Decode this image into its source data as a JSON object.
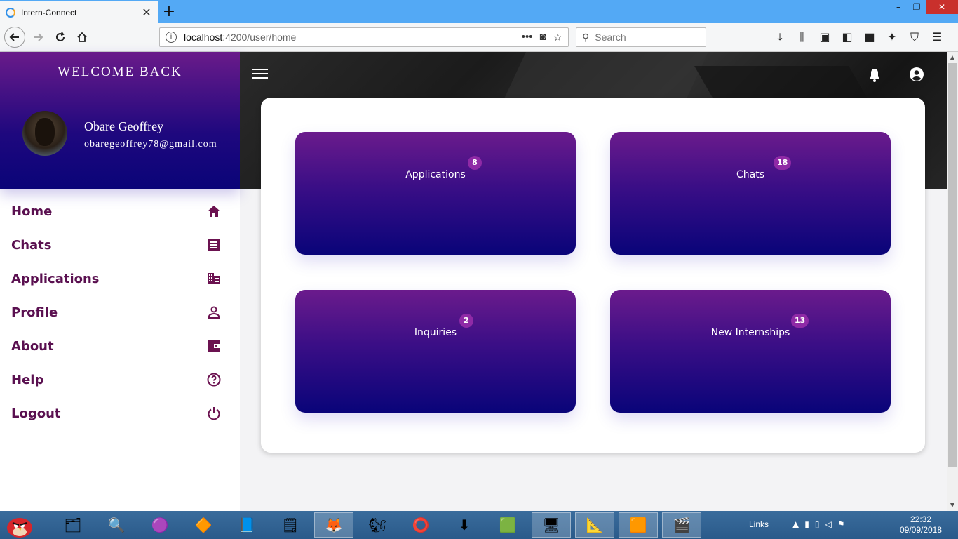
{
  "browser": {
    "tab_title": "Intern-Connect",
    "tab_close": "✕",
    "new_tab": "+",
    "url_host": "localhost",
    "url_path": ":4200/user/home",
    "search_placeholder": "Search",
    "window_controls": [
      "–",
      "❐",
      "✕"
    ]
  },
  "sidebar": {
    "welcome": "WELCOME BACK",
    "user_name": "Obare Geoffrey",
    "user_email": "obaregeoffrey78@gmail.com",
    "menu": [
      {
        "label": "Home",
        "icon": "home-icon"
      },
      {
        "label": "Chats",
        "icon": "chat-list-icon"
      },
      {
        "label": "Applications",
        "icon": "building-icon"
      },
      {
        "label": "Profile",
        "icon": "person-icon"
      },
      {
        "label": "About",
        "icon": "wallet-icon"
      },
      {
        "label": "Help",
        "icon": "help-circle-icon"
      },
      {
        "label": "Logout",
        "icon": "power-icon"
      }
    ]
  },
  "dashboard": {
    "tiles": [
      {
        "label": "Applications",
        "count": "8"
      },
      {
        "label": "Chats",
        "count": "18"
      },
      {
        "label": "Inquiries",
        "count": "2"
      },
      {
        "label": "New Internships",
        "count": "13"
      }
    ]
  },
  "taskbar": {
    "links_label": "Links",
    "clock_time": "22:32",
    "clock_date": "09/09/2018"
  },
  "colors": {
    "accent_purple": "#6b1b8c",
    "accent_navy": "#090479",
    "menu_text": "#5a1050",
    "badge": "#8f2aa6"
  }
}
